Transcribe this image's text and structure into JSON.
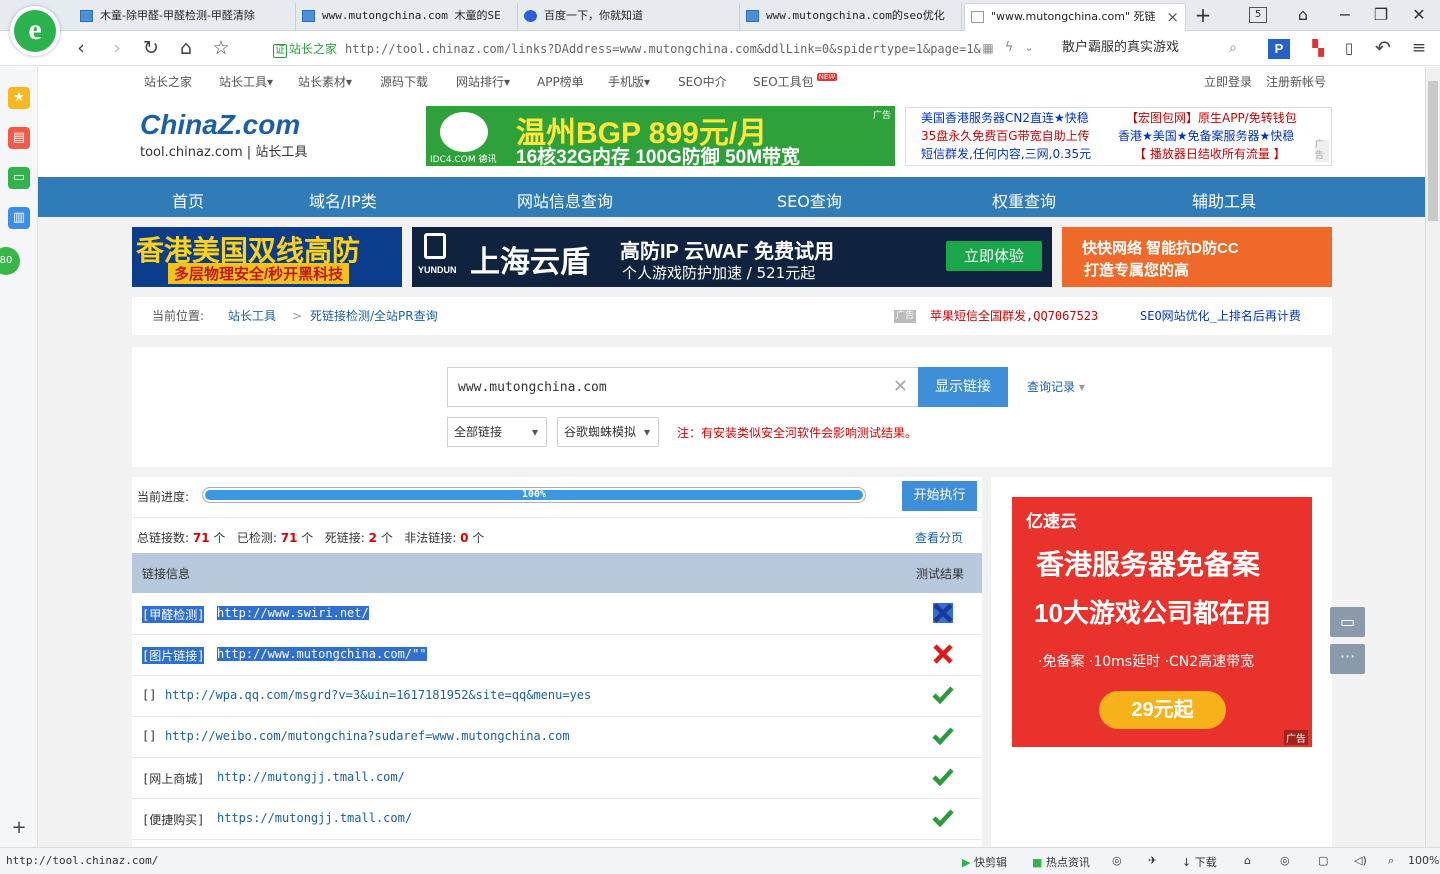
{
  "tabs": [
    {
      "label": "木童-除甲醛-甲醛检测-甲醛清除"
    },
    {
      "label": "www.mutongchina.com 木童的SE"
    },
    {
      "label": "百度一下，你就知道"
    },
    {
      "label": "www.mutongchina.com的seo优化"
    },
    {
      "label": "\"www.mutongchina.com\" 死链接"
    }
  ],
  "tab_count": "5",
  "address": {
    "site_label": "站长之家",
    "url": "http://tool.chinaz.com/links?DAddress=www.mutongchina.com&ddlLink=0&spidertype=1&page=1&",
    "search_text": "散户霸服的真实游戏"
  },
  "top_nav": {
    "items": [
      "站长之家",
      "站长工具",
      "站长素材",
      "源码下载",
      "网站排行",
      "APP榜单",
      "手机版",
      "SEO中介",
      "SEO工具包"
    ],
    "new_badge": "NEW",
    "login": "立即登录",
    "register": "注册新帐号"
  },
  "header": {
    "logo_main": "ChinaZ.com",
    "logo_sub": "tool.chinaz.com | 站长工具",
    "banner_title": "温州BGP 899元/月",
    "banner_sub": "16核32G内存 100G防御 50M带宽",
    "banner_brand": "IDC4.COM 德讯",
    "ad_tag": "广告",
    "text_ads": [
      "美国香港服务器CN2直连★快稳",
      "【宏图包网】原生APP/免转钱包",
      "35盘永久免费百G带宽自助上传",
      "香港★美国★免备案服务器★快稳",
      "短信群发,任何内容,三网,0.35元",
      "【 播放器日结收所有流量 】"
    ]
  },
  "main_nav": [
    "首页",
    "域名/IP类",
    "网站信息查询",
    "SEO查询",
    "权重查询",
    "辅助工具"
  ],
  "banners": {
    "left_title": "香港美国双线高防",
    "left_sub": "多层物理安全/秒开黑科技",
    "mid_brand": "YUNDUN",
    "mid_title": "上海云盾",
    "mid_line1": "高防IP 云WAF 免费试用",
    "mid_line2": "个人游戏防护加速 / 521元起",
    "mid_button": "立即体验",
    "right_line1": "快快网络 智能抗D防CC",
    "right_line2": "打造专属您的高"
  },
  "breadcrumb": {
    "label": "当前位置:",
    "item1": "站长工具",
    "sep": ">",
    "item2": "死链接检测/全站PR查询",
    "ad_tag": "广告",
    "ad1": "苹果短信全国群发,QQ7067523",
    "ad2": "SEO网站优化_上排名后再计费"
  },
  "query": {
    "input_value": "www.mutongchina.com",
    "submit_label": "显示链接",
    "history_label": "查询记录",
    "link_type": "全部链接",
    "spider_type": "谷歌蜘蛛模拟",
    "notice": "注：有安装类似安全河软件会影响测试结果。"
  },
  "progress": {
    "label": "当前进度:",
    "percent_text": "100%",
    "value": 1.0,
    "start_label": "开始执行"
  },
  "stats": {
    "total_label": "总链接数:",
    "total": "71",
    "checked_label": "已检测:",
    "checked": "71",
    "dead_label": "死链接:",
    "dead": "2",
    "illegal_label": "非法链接:",
    "illegal": "0",
    "unit": "个",
    "paging_label": "查看分页"
  },
  "table": {
    "col_info": "链接信息",
    "col_result": "测试结果",
    "rows": [
      {
        "label": "[甲醛检测]",
        "url": "http://www.swiri.net/",
        "result": "dead-blue",
        "selected": true
      },
      {
        "label": "[图片链接]",
        "url": "http://www.mutongchina.com/\"\"",
        "result": "dead",
        "selected": true
      },
      {
        "label": "[]",
        "url": "http://wpa.qq.com/msgrd?v=3&uin=1617181952&site=qq&menu=yes",
        "result": "ok",
        "selected": false
      },
      {
        "label": "[]",
        "url": "http://weibo.com/mutongchina?sudaref=www.mutongchina.com",
        "result": "ok",
        "selected": false
      },
      {
        "label": "[网上商城]",
        "url": "http://mutongjj.tmall.com/",
        "result": "ok",
        "selected": false
      },
      {
        "label": "[便捷购买]",
        "url": "https://mutongjj.tmall.com/",
        "result": "ok",
        "selected": false
      }
    ]
  },
  "side_ad": {
    "brand": "亿速云",
    "line1": "香港服务器免备案",
    "line2": "10大游戏公司都在用",
    "line3": "·免备案  ·10ms延时  ·CN2高速带宽",
    "button": "29元起",
    "tag": "广告"
  },
  "sidebar_badge": "80",
  "status": {
    "url": "http://tool.chinaz.com/",
    "clip": "快剪辑",
    "hot": "热点资讯",
    "download": "下载",
    "zoom": "100%"
  }
}
